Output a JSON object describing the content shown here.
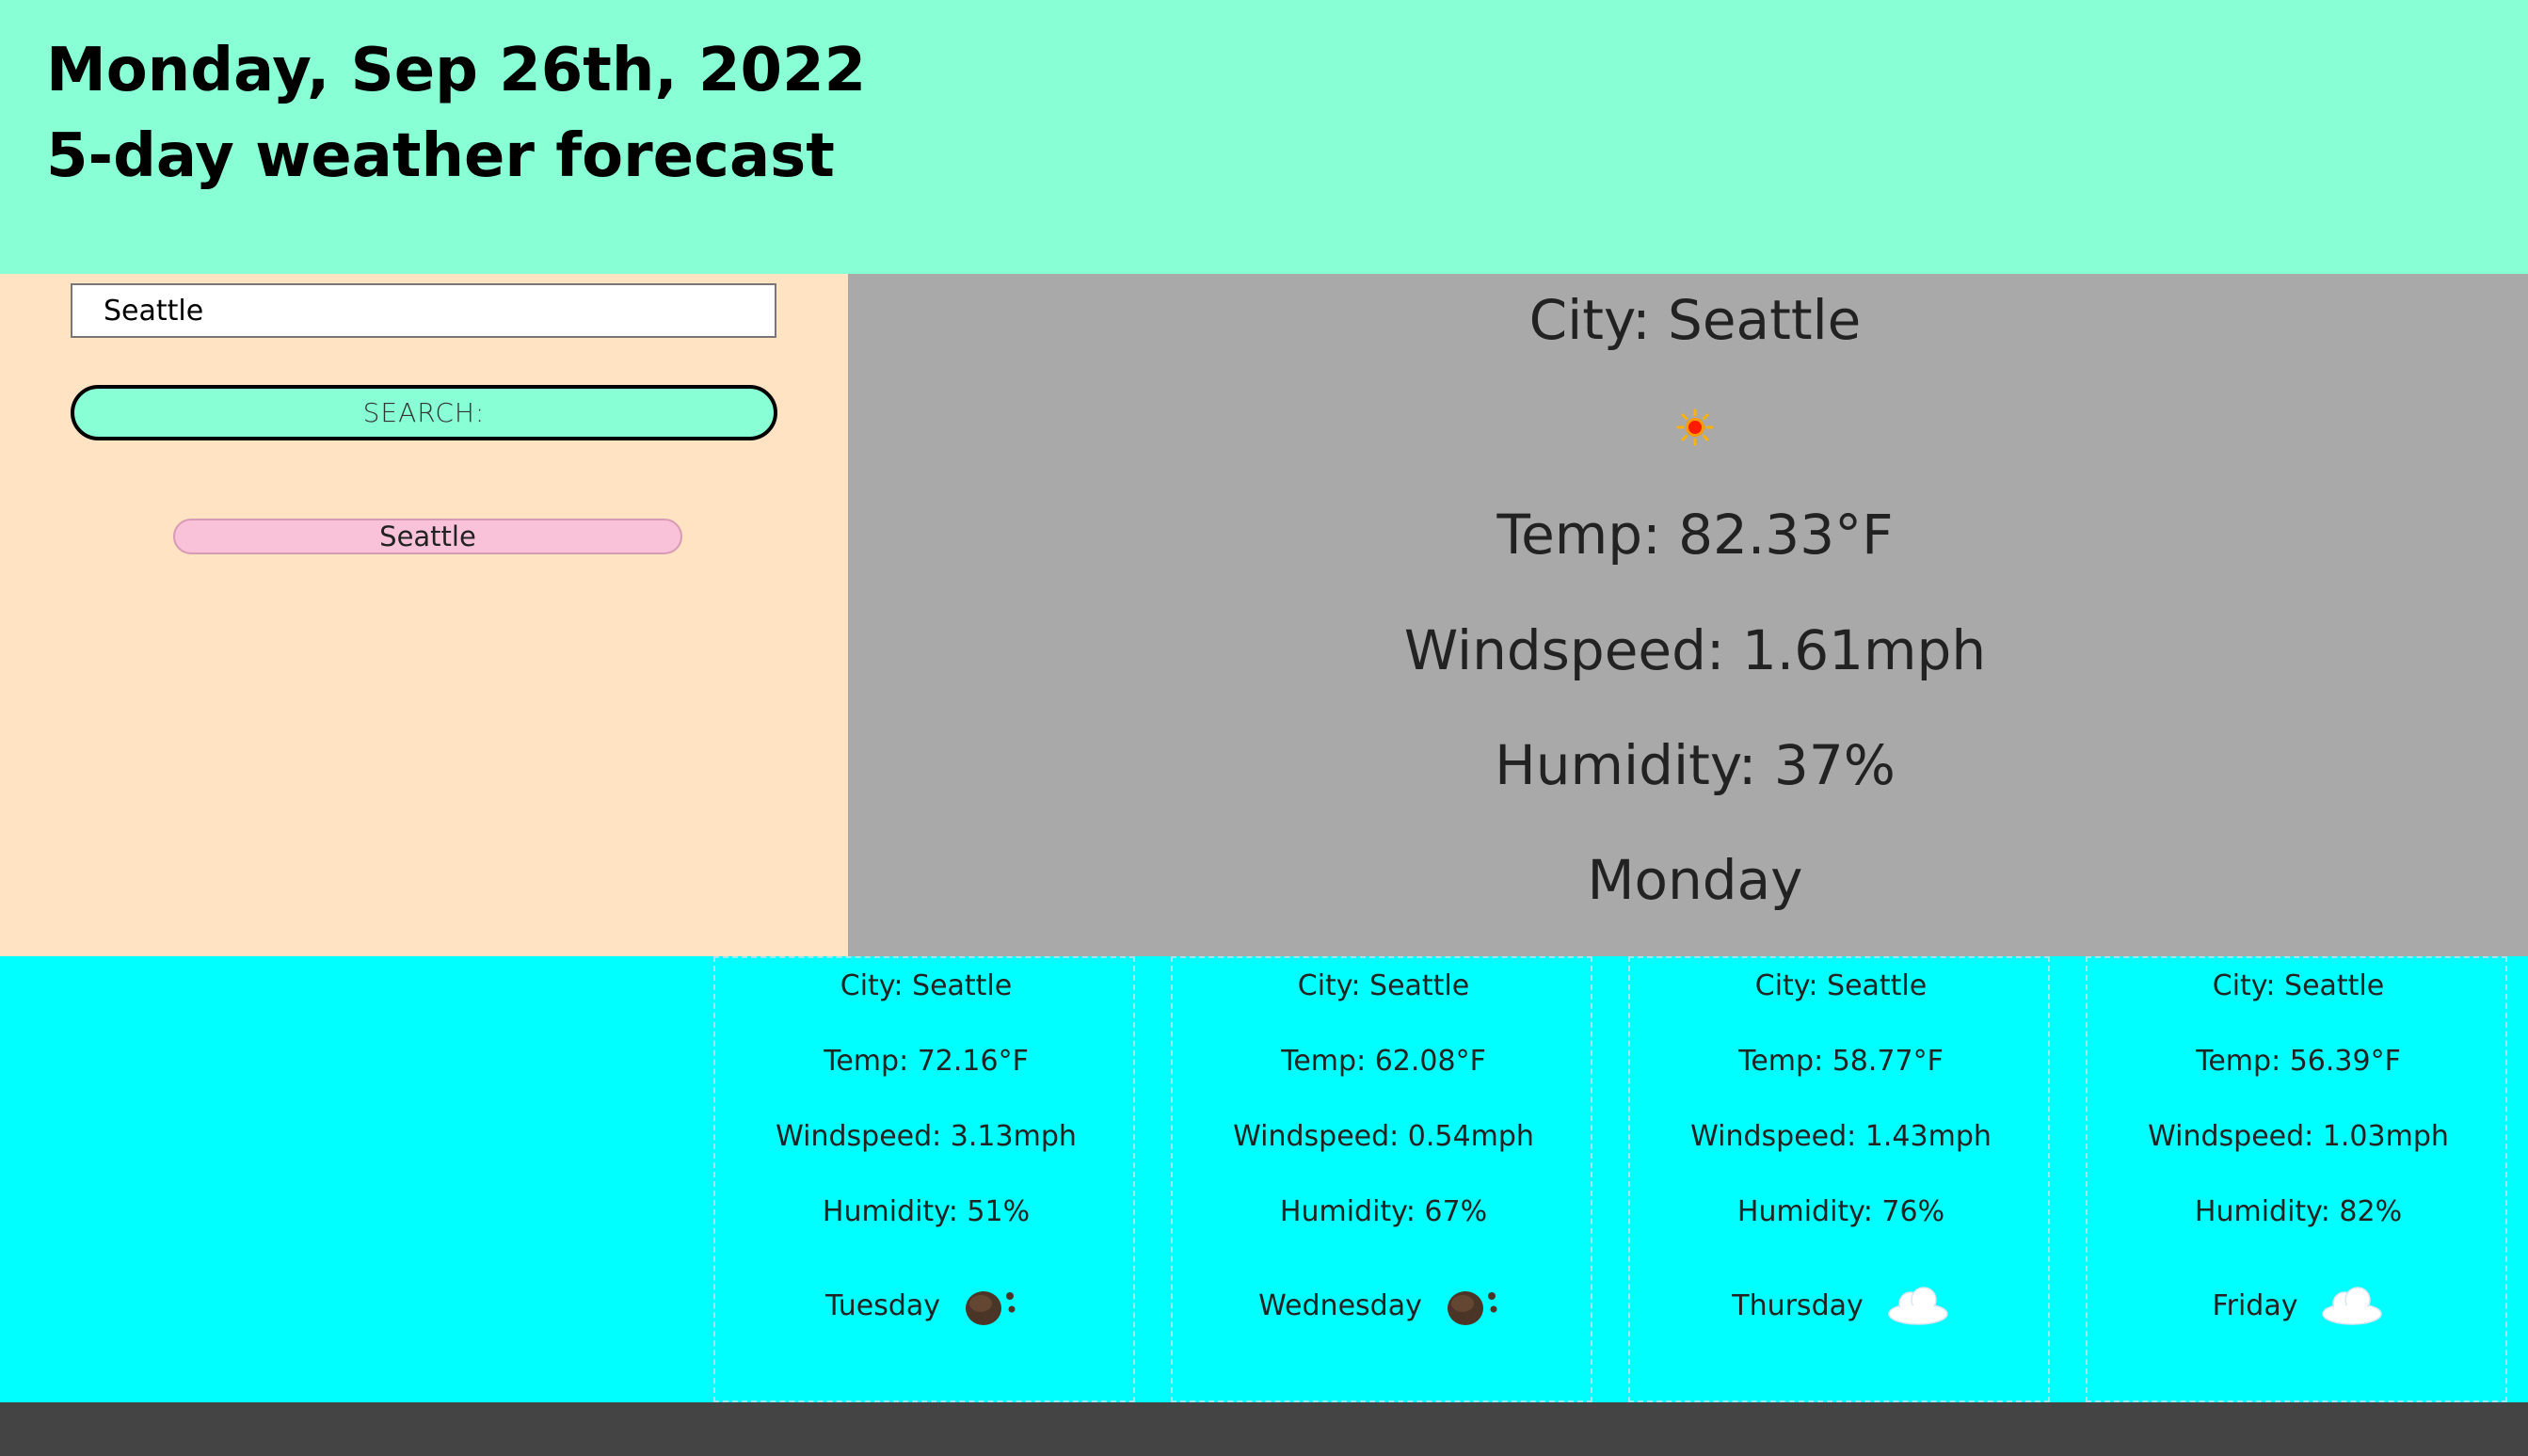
{
  "header": {
    "date": "Monday, Sep 26th, 2022",
    "subtitle": "5-day weather forecast"
  },
  "sidebar": {
    "search_value": "Seattle",
    "search_button_label": "SEARCH:",
    "history": [
      "Seattle"
    ]
  },
  "current": {
    "city": "City: Seattle",
    "icon": "sun-icon",
    "temp": "Temp: 82.33°F",
    "wind": "Windspeed: 1.61mph",
    "humidity": "Humidity: 37%",
    "day": "Monday"
  },
  "forecast": [
    {
      "city": "City: Seattle",
      "temp": "Temp: 72.16°F",
      "wind": "Windspeed: 3.13mph",
      "humidity": "Humidity: 51%",
      "day": "Tuesday",
      "icon": "few-clouds-night-icon"
    },
    {
      "city": "City: Seattle",
      "temp": "Temp: 62.08°F",
      "wind": "Windspeed: 0.54mph",
      "humidity": "Humidity: 67%",
      "day": "Wednesday",
      "icon": "few-clouds-night-icon"
    },
    {
      "city": "City: Seattle",
      "temp": "Temp: 58.77°F",
      "wind": "Windspeed: 1.43mph",
      "humidity": "Humidity: 76%",
      "day": "Thursday",
      "icon": "cloud-icon"
    },
    {
      "city": "City: Seattle",
      "temp": "Temp: 56.39°F",
      "wind": "Windspeed: 1.03mph",
      "humidity": "Humidity: 82%",
      "day": "Friday",
      "icon": "cloud-icon"
    }
  ],
  "colors": {
    "header_bg": "#88ffd4",
    "sidebar_bg": "#ffe3c2",
    "current_bg": "#a9a9a9",
    "forecast_bg": "#00ffff",
    "history_button_bg": "#f9c2d9",
    "footer_bg": "#444444"
  }
}
